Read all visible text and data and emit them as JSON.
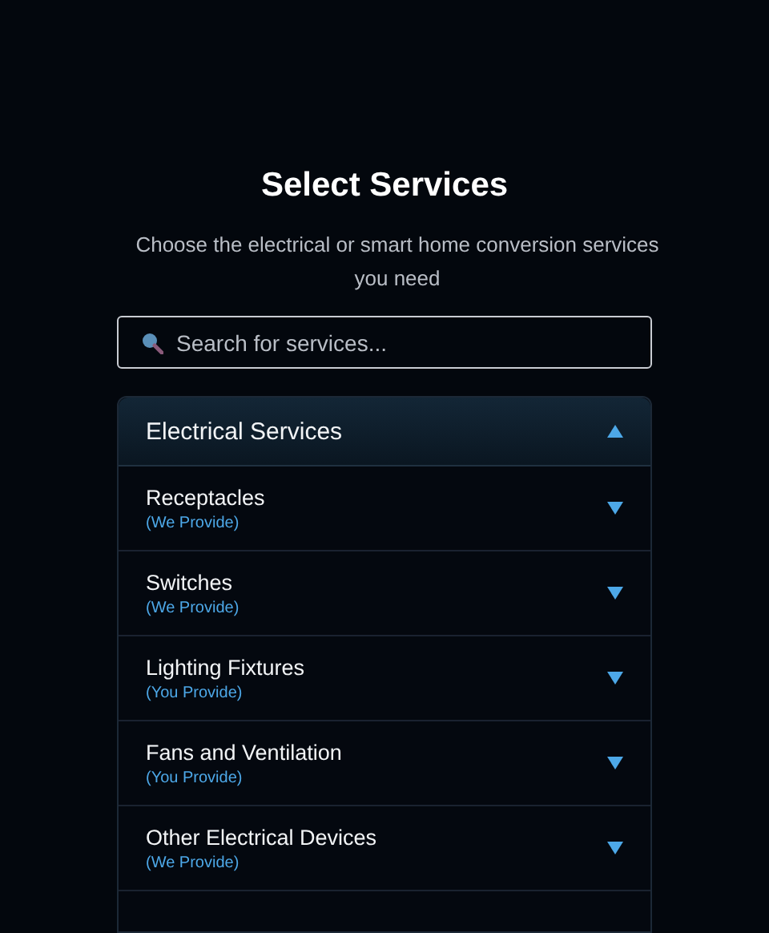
{
  "title": "Select Services",
  "subtitle": "Choose the electrical or smart home conversion services you need",
  "search": {
    "placeholder": "Search for services..."
  },
  "section": {
    "title": "Electrical Services",
    "expanded": true,
    "items": [
      {
        "name": "Receptacles",
        "note": "(We Provide)",
        "expanded": false
      },
      {
        "name": "Switches",
        "note": "(We Provide)",
        "expanded": false
      },
      {
        "name": "Lighting Fixtures",
        "note": "(You Provide)",
        "expanded": false
      },
      {
        "name": "Fans and Ventilation",
        "note": "(You Provide)",
        "expanded": false
      },
      {
        "name": "Other Electrical Devices",
        "note": "(We Provide)",
        "expanded": false
      }
    ]
  }
}
